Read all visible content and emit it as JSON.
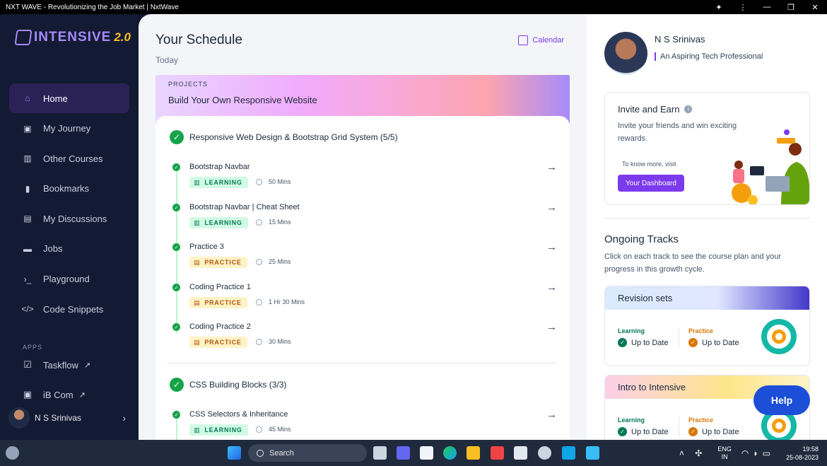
{
  "window": {
    "title": "NXT WAVE - Revolutionizing the Job Market | NxtWave"
  },
  "sidebar": {
    "logo_text": "INTENSIVE",
    "logo_version": "2.0",
    "items": [
      {
        "label": "Home",
        "icon": "home-icon"
      },
      {
        "label": "My Journey",
        "icon": "journey-icon"
      },
      {
        "label": "Other Courses",
        "icon": "book-icon"
      },
      {
        "label": "Bookmarks",
        "icon": "bookmark-icon"
      },
      {
        "label": "My Discussions",
        "icon": "discussion-icon"
      },
      {
        "label": "Jobs",
        "icon": "briefcase-icon"
      },
      {
        "label": "Playground",
        "icon": "terminal-icon"
      },
      {
        "label": "Code Snippets",
        "icon": "code-icon"
      }
    ],
    "apps_label": "APPS",
    "apps": [
      {
        "label": "Taskflow"
      },
      {
        "label": "iB Com"
      }
    ],
    "user_name": "N S Srinivas"
  },
  "schedule": {
    "title": "Your Schedule",
    "subtitle": "Today",
    "calendar_label": "Calendar",
    "project_label": "PROJECTS",
    "project_title": "Build Your Own Responsive Website",
    "sections": [
      {
        "title": "Responsive Web Design & Bootstrap Grid System (5/5)",
        "lessons": [
          {
            "title": "Bootstrap Navbar",
            "tag": "LEARNING",
            "duration": "50 Mins"
          },
          {
            "title": "Bootstrap Navbar | Cheat Sheet",
            "tag": "LEARNING",
            "duration": "15 Mins"
          },
          {
            "title": "Practice 3",
            "tag": "PRACTICE",
            "duration": "25 Mins"
          },
          {
            "title": "Coding Practice 1",
            "tag": "PRACTICE",
            "duration": "1 Hr 30 Mins"
          },
          {
            "title": "Coding Practice 2",
            "tag": "PRACTICE",
            "duration": "30 Mins"
          }
        ]
      },
      {
        "title": "CSS Building Blocks (3/3)",
        "lessons": [
          {
            "title": "CSS Selectors & Inheritance",
            "tag": "LEARNING",
            "duration": "45 Mins"
          }
        ]
      }
    ]
  },
  "profile": {
    "name": "N S Srinivas",
    "tagline": "An Aspiring Tech Professional"
  },
  "invite": {
    "title": "Invite and Earn",
    "description": "Invite your friends and win exciting rewards.",
    "know_more": "To know more, visit",
    "button": "Your Dashboard"
  },
  "ongoing": {
    "title": "Ongoing Tracks",
    "description": "Click on each track to see the course plan and your progress in this growth cycle.",
    "tracks": [
      {
        "name": "Revision sets",
        "learning_label": "Learning",
        "learning_status": "Up to Date",
        "practice_label": "Practice",
        "practice_status": "Up to Date"
      },
      {
        "name": "Intro to Intensive",
        "learning_label": "Learning",
        "learning_status": "Up to Date",
        "practice_label": "Practice",
        "practice_status": "Up to Date"
      }
    ]
  },
  "help_label": "Help",
  "taskbar": {
    "search_label": "Search",
    "lang_line1": "ENG",
    "lang_line2": "IN",
    "time": "19:58",
    "date": "25-08-2023"
  },
  "colors": {
    "accent": "#7c3aed",
    "success": "#16a34a",
    "learning_tag": "#047857",
    "practice_tag": "#b45309",
    "sidebar_bg": "#131a33"
  }
}
